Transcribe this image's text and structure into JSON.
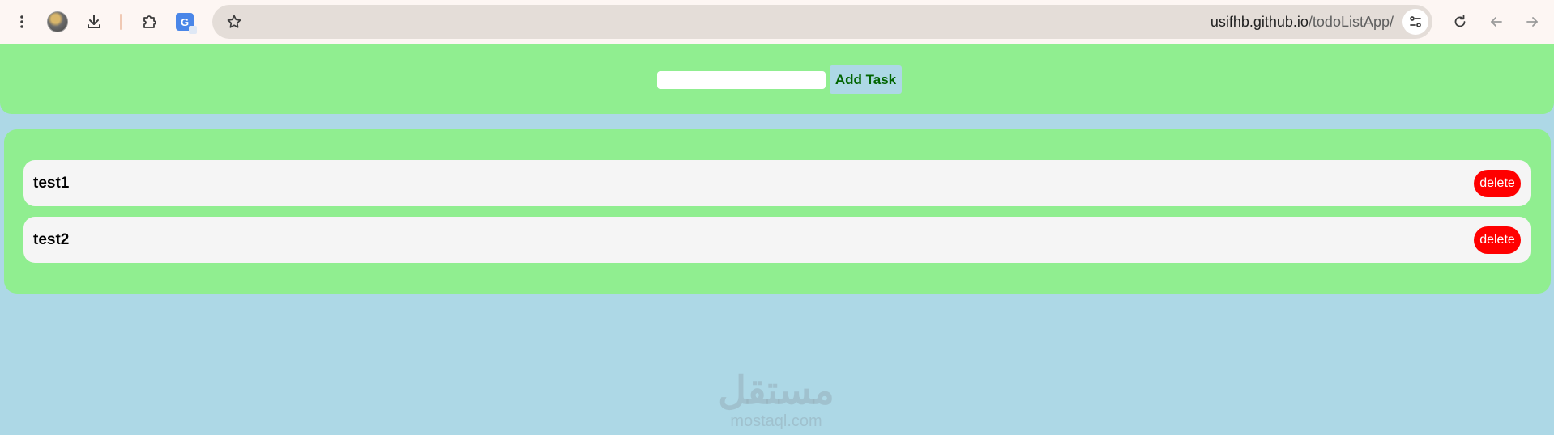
{
  "browser": {
    "url_host": "usifhb.github.io",
    "url_path": "/todoListApp/"
  },
  "form": {
    "input_value": "",
    "input_placeholder": "",
    "add_button_label": "Add Task"
  },
  "tasks": [
    {
      "text": "test1",
      "delete_label": "delete"
    },
    {
      "text": "test2",
      "delete_label": "delete"
    }
  ],
  "watermark": {
    "arabic": "مستقل",
    "latin": "mostaql.com"
  },
  "colors": {
    "page_background": "#add8e6",
    "panel_background": "#90ee90",
    "item_background": "#f5f5f5",
    "delete_button": "#ff0000",
    "add_button": "#add8e6",
    "add_button_text": "#006400"
  },
  "icons": {
    "menu": "more-vert-icon",
    "profile": "avatar",
    "download": "download-icon",
    "extensions": "puzzle-icon",
    "translate": "translate-icon",
    "bookmark": "star-icon",
    "site_settings": "tune-icon",
    "reload": "reload-icon",
    "back": "back-arrow-icon",
    "forward": "forward-arrow-icon"
  }
}
